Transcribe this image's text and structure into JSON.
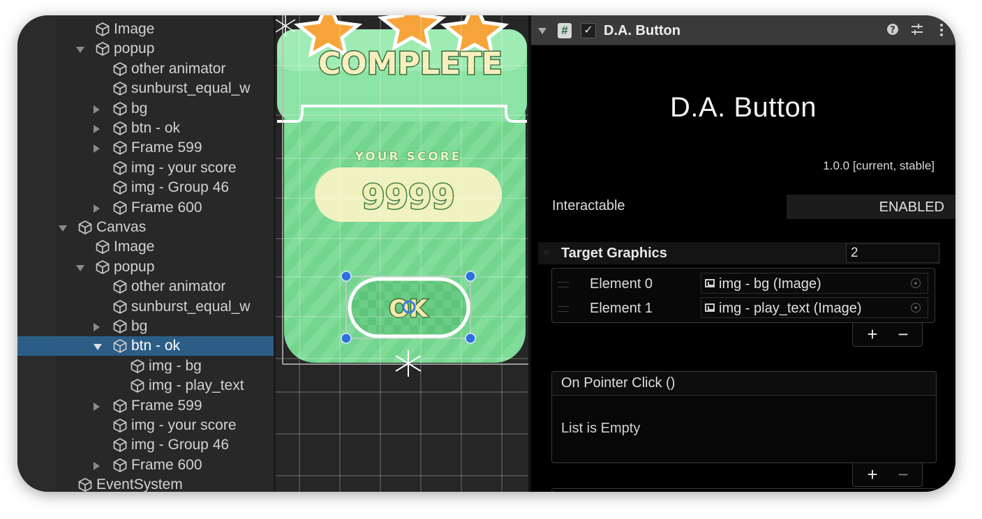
{
  "hierarchy": {
    "items": [
      {
        "label": "Image",
        "icon": "cube-icon",
        "indent": 1,
        "foldout": "none",
        "selected": false
      },
      {
        "label": "popup",
        "icon": "cube-icon",
        "indent": 1,
        "foldout": "open",
        "selected": false
      },
      {
        "label": "other animator",
        "icon": "cube-icon",
        "indent": 2,
        "foldout": "none",
        "selected": false
      },
      {
        "label": "sunburst_equal_w",
        "icon": "cube-icon",
        "indent": 2,
        "foldout": "none",
        "selected": false
      },
      {
        "label": "bg",
        "icon": "cube-icon",
        "indent": 2,
        "foldout": "closed",
        "selected": false
      },
      {
        "label": "btn - ok",
        "icon": "cube-icon",
        "indent": 2,
        "foldout": "closed",
        "selected": false
      },
      {
        "label": "Frame 599",
        "icon": "cube-icon",
        "indent": 2,
        "foldout": "closed",
        "selected": false
      },
      {
        "label": "img - your score",
        "icon": "cube-icon",
        "indent": 2,
        "foldout": "none",
        "selected": false
      },
      {
        "label": "img - Group 46",
        "icon": "cube-icon",
        "indent": 2,
        "foldout": "none",
        "selected": false
      },
      {
        "label": "Frame 600",
        "icon": "cube-icon",
        "indent": 2,
        "foldout": "closed",
        "selected": false
      },
      {
        "label": "Canvas",
        "icon": "cube-icon",
        "indent": 0,
        "foldout": "open",
        "selected": false
      },
      {
        "label": "Image",
        "icon": "cube-icon",
        "indent": 1,
        "foldout": "none",
        "selected": false
      },
      {
        "label": "popup",
        "icon": "cube-icon",
        "indent": 1,
        "foldout": "open",
        "selected": false
      },
      {
        "label": "other animator",
        "icon": "cube-icon",
        "indent": 2,
        "foldout": "none",
        "selected": false
      },
      {
        "label": "sunburst_equal_w",
        "icon": "cube-icon",
        "indent": 2,
        "foldout": "none",
        "selected": false
      },
      {
        "label": "bg",
        "icon": "cube-icon",
        "indent": 2,
        "foldout": "closed",
        "selected": false
      },
      {
        "label": "btn - ok",
        "icon": "cube-icon",
        "indent": 2,
        "foldout": "open",
        "selected": true
      },
      {
        "label": "img - bg",
        "icon": "cube-icon",
        "indent": 3,
        "foldout": "none",
        "selected": false
      },
      {
        "label": "img - play_text",
        "icon": "cube-icon",
        "indent": 3,
        "foldout": "none",
        "selected": false
      },
      {
        "label": "Frame 599",
        "icon": "cube-icon",
        "indent": 2,
        "foldout": "closed",
        "selected": false
      },
      {
        "label": "img - your score",
        "icon": "cube-icon",
        "indent": 2,
        "foldout": "none",
        "selected": false
      },
      {
        "label": "img - Group 46",
        "icon": "cube-icon",
        "indent": 2,
        "foldout": "none",
        "selected": false
      },
      {
        "label": "Frame 600",
        "icon": "cube-icon",
        "indent": 2,
        "foldout": "closed",
        "selected": false
      },
      {
        "label": "EventSystem",
        "icon": "cube-icon",
        "indent": 0,
        "foldout": "none",
        "selected": false
      }
    ],
    "selected_color": "#2c5d87"
  },
  "scene": {
    "popup_title": "COMPLETE",
    "score_label": "YOUR SCORE",
    "score_value": "9999",
    "button_text": "OK",
    "accent_green": "#6fd58b",
    "score_text_color": "#f3eaaa"
  },
  "inspector": {
    "component_title": "D.A. Button",
    "enabled": true,
    "script_icon": "script-hash-icon",
    "header_icons": [
      "help-icon",
      "presets-icon",
      "kebab-menu-icon"
    ],
    "big_title": "D.A. Button",
    "version": "1.0.0 [current, stable]",
    "interactable_label": "Interactable",
    "interactable_value": "ENABLED",
    "target_graphics_label": "Target Graphics",
    "target_graphics_count": "2",
    "elements": [
      {
        "label": "Element 0",
        "value": "img - bg (Image)"
      },
      {
        "label": "Element 1",
        "value": "img - play_text (Image)"
      }
    ],
    "add_label": "+",
    "remove_label": "−",
    "event_title": "On Pointer Click ()",
    "event_empty": "List is Empty"
  }
}
